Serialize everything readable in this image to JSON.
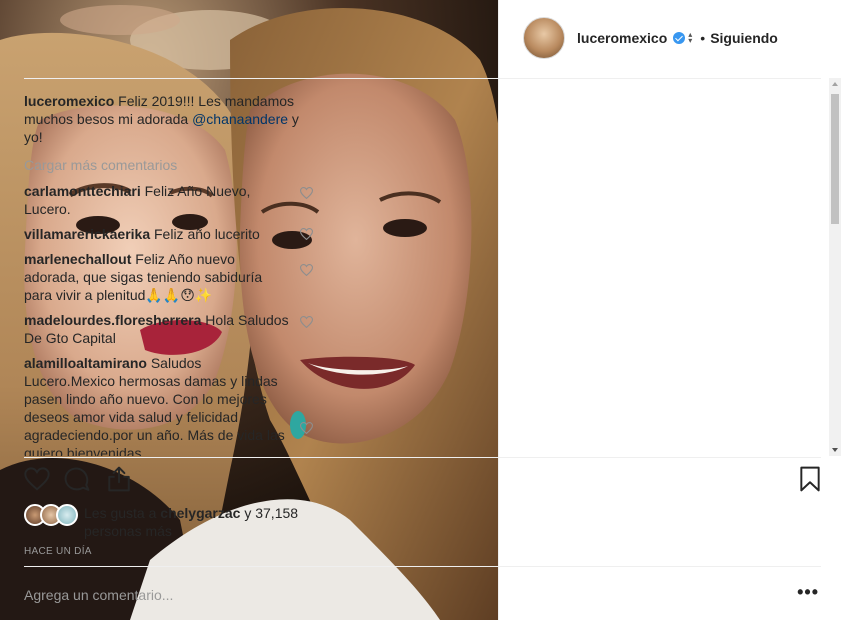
{
  "header": {
    "username": "luceromexico",
    "follow_label": "Siguiendo",
    "separator": "•"
  },
  "caption": {
    "username": "luceromexico",
    "text_before": "Feliz 2019!!! Les mandamos muchos besos mi adorada ",
    "mention": "@chanaandere",
    "text_after": " y yo!"
  },
  "load_more_label": "Cargar más comentarios",
  "comments": [
    {
      "username": "carlamonttechiari",
      "text": "Feliz Año Nuevo, Lucero."
    },
    {
      "username": "villamarerickaerika",
      "text": "Feliz año lucerito"
    },
    {
      "username": "marlenechallout",
      "text": "Feliz Año nuevo adorada, que sigas teniendo sabiduría para vivir a plenitud🙏🙏😯✨"
    },
    {
      "username": "madelourdes.floresherrera",
      "text": "Hola Saludos De Gto Capital"
    },
    {
      "username": "alamilloaltamirano",
      "text": "Saludos Lucero.Mexico hermosas damas y lindas pasen lindo año nuevo. Con lo mejores deseos amor vida salud y felicidad agradeciendo.por un año. Más de vida las quiero bienvenidas"
    }
  ],
  "likes": {
    "prefix": "Les gusta a ",
    "user": "chelygarzac",
    "suffix": " y 37,158 personas más"
  },
  "timestamp": "HACE UN DÍA",
  "add_comment_placeholder": "Agrega un comentario...",
  "more_label": "•••",
  "icons": {
    "like": "heart-icon",
    "comment": "comment-icon",
    "share": "share-icon",
    "save": "bookmark-icon",
    "verified": "verified-badge-icon"
  },
  "colors": {
    "verified": "#3897f0",
    "mention": "#003569",
    "muted": "#999999",
    "text": "#262626"
  }
}
